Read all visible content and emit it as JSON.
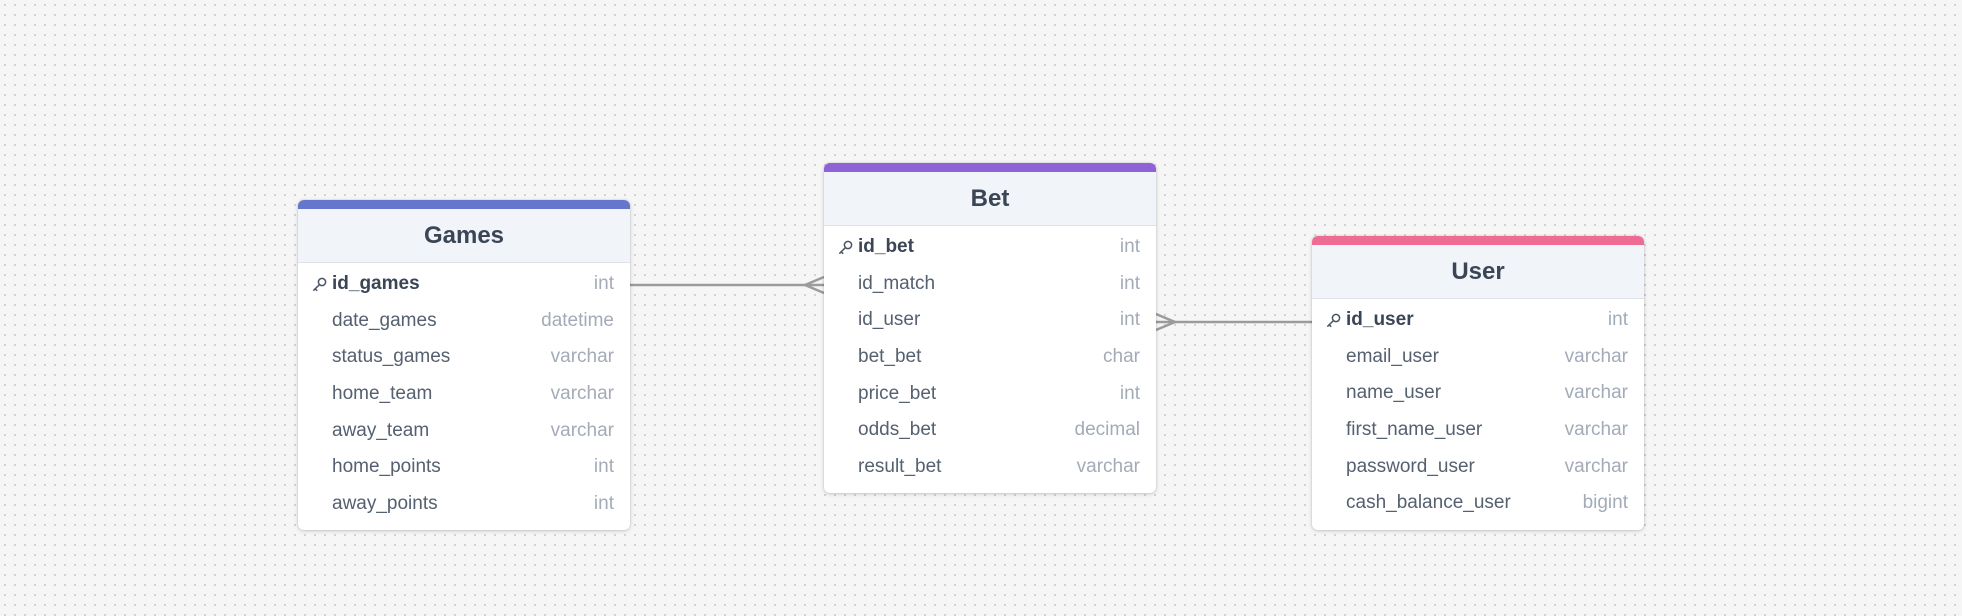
{
  "colors": {
    "background": "#f6f6f6",
    "connector": "#9b9b9b",
    "games_accent": "#6577cc",
    "bet_accent": "#8f62d8",
    "user_accent": "#ee6c94"
  },
  "tables": {
    "games": {
      "title": "Games",
      "accent": "#6577cc",
      "columns": [
        {
          "name": "id_games",
          "type": "int",
          "primary_key": true
        },
        {
          "name": "date_games",
          "type": "datetime"
        },
        {
          "name": "status_games",
          "type": "varchar"
        },
        {
          "name": "home_team",
          "type": "varchar"
        },
        {
          "name": "away_team",
          "type": "varchar"
        },
        {
          "name": "home_points",
          "type": "int"
        },
        {
          "name": "away_points",
          "type": "int"
        }
      ]
    },
    "bet": {
      "title": "Bet",
      "accent": "#8f62d8",
      "columns": [
        {
          "name": "id_bet",
          "type": "int",
          "primary_key": true
        },
        {
          "name": "id_match",
          "type": "int"
        },
        {
          "name": "id_user",
          "type": "int"
        },
        {
          "name": "bet_bet",
          "type": "char"
        },
        {
          "name": "price_bet",
          "type": "int"
        },
        {
          "name": "odds_bet",
          "type": "decimal"
        },
        {
          "name": "result_bet",
          "type": "varchar"
        }
      ]
    },
    "user": {
      "title": "User",
      "accent": "#ee6c94",
      "columns": [
        {
          "name": "id_user",
          "type": "int",
          "primary_key": true
        },
        {
          "name": "email_user",
          "type": "varchar"
        },
        {
          "name": "name_user",
          "type": "varchar"
        },
        {
          "name": "first_name_user",
          "type": "varchar"
        },
        {
          "name": "password_user",
          "type": "varchar"
        },
        {
          "name": "cash_balance_user",
          "type": "bigint"
        }
      ]
    }
  },
  "relationships": [
    {
      "from": "games.id_games",
      "to": "bet.id_match",
      "cardinality": "one-to-many"
    },
    {
      "from": "user.id_user",
      "to": "bet.id_user",
      "cardinality": "one-to-many"
    }
  ]
}
